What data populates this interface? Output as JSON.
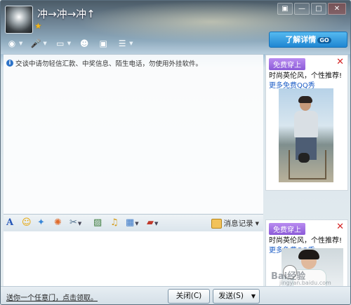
{
  "titlebar": {
    "username": "冲→冲→冲↑",
    "status_icon": "star-icon",
    "window_buttons": [
      "▣",
      "—",
      "□",
      "✕"
    ]
  },
  "toolbar": {
    "items": [
      {
        "name": "video-call-icon",
        "glyph": "◉"
      },
      {
        "name": "voice-call-icon",
        "glyph": "🎤"
      },
      {
        "name": "file-transfer-icon",
        "glyph": "▭"
      },
      {
        "name": "contact-card-icon",
        "glyph": "☻"
      },
      {
        "name": "remote-desktop-icon",
        "glyph": "▣"
      },
      {
        "name": "app-menu-icon",
        "glyph": "☰"
      }
    ]
  },
  "chat": {
    "notice": "交谈中请勿轻信汇款、中奖信息、陌生电话，勿使用外挂软件。"
  },
  "ads": {
    "detail_button": "了解详情",
    "detail_go": "GO",
    "top": {
      "badge": "免费穿上",
      "line1": "时尚英伦风，个性推荐!",
      "line2": "更多免费QQ秀",
      "close": "✕"
    },
    "bottom": {
      "badge": "免费穿上",
      "line1": "时尚英伦风，个性推荐!",
      "line2": "更多免费QQ秀",
      "close": "✕"
    }
  },
  "input_toolbar": {
    "font_icon": "A",
    "emoji_icon": "☺",
    "history_label": "消息记录"
  },
  "bottom_bar": {
    "promo_link": "送你一个任意门，点击领取。",
    "close_button": "关闭(C)",
    "send_button": "发送(S)",
    "send_dropdown": "▼"
  },
  "watermark": {
    "brand": "Bai经验",
    "url": "jingyan.baidu.com"
  },
  "colors": {
    "accent_blue": "#1f86d2",
    "ad_badge": "#8b5ad8",
    "ad_link": "#1b5cc6"
  }
}
